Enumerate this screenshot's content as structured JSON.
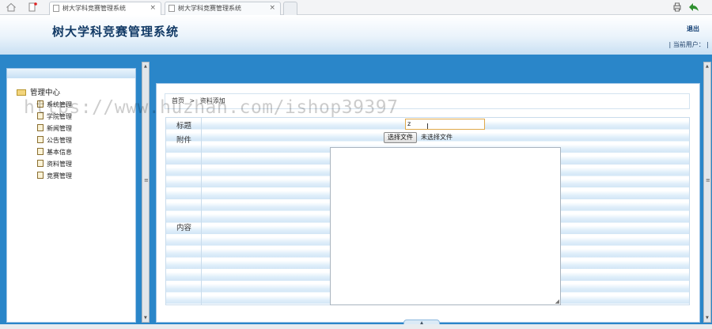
{
  "browser": {
    "tabs": [
      {
        "title": "树大学科竞赛管理系统",
        "close": "×"
      },
      {
        "title": "树大学科竞赛管理系统",
        "close": "×"
      }
    ]
  },
  "header": {
    "title": "树大学科竞赛管理系统",
    "logout": "退出",
    "user_label": "| 当前用户： |"
  },
  "sidebar": {
    "root": "管理中心",
    "items": [
      {
        "label": "系统管理"
      },
      {
        "label": "学院管理"
      },
      {
        "label": "新闻管理"
      },
      {
        "label": "公告管理"
      },
      {
        "label": "基本信息"
      },
      {
        "label": "资料管理"
      },
      {
        "label": "竞赛管理"
      }
    ]
  },
  "breadcrumb": {
    "home": "首页",
    "separator": ">",
    "current": "资料添加"
  },
  "form": {
    "title_label": "标题",
    "title_value": "z",
    "attachment_label": "附件",
    "file_button": "选择文件",
    "file_status": "未选择文件",
    "content_label": "内容",
    "content_value": ""
  },
  "watermark": "https://www.huzhan.com/ishop39397",
  "colors": {
    "header_band": "#2a86c9",
    "title_text": "#123a66",
    "input_focus_border": "#e0a84a"
  }
}
